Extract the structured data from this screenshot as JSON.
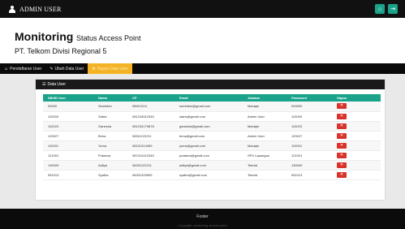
{
  "app": {
    "title": "ADMIN USER"
  },
  "topbar": {
    "home_icon": "home-icon",
    "logout_icon": "logout-icon"
  },
  "header": {
    "title_bold": "Monitoring",
    "title_rest": "Status Access Point",
    "subtitle": "PT. Telkom Divisi Regional 5"
  },
  "nav": {
    "items": [
      {
        "label": "Pendaftaran User",
        "icon": "user-plus-icon"
      },
      {
        "label": "Ubah Data User",
        "icon": "pencil-icon"
      },
      {
        "label": "Hapus Data User",
        "icon": "trash-icon",
        "active": true
      }
    ]
  },
  "panel": {
    "title": "Data User",
    "icon": "list-icon"
  },
  "table": {
    "columns": [
      "NIK/ID User",
      "Nama",
      "CP",
      "Email",
      "Jabatan",
      "Password",
      "Hapus"
    ],
    "rows": [
      [
        "00000",
        "Sembilan",
        "0892131X",
        "sembilan@gmail.com",
        "Manajer",
        "000000"
      ],
      [
        "110000",
        "Satria",
        "081234512345",
        "satria@gmail.com",
        "Admin User",
        "110000"
      ],
      [
        "110023",
        "Ganesha",
        "081234179878",
        "ganesha@gmail.com",
        "Manajer",
        "110023"
      ],
      [
        "120027",
        "Brina",
        "08311122211",
        "brina@gmail.com",
        "Admin User",
        "120027"
      ],
      [
        "110001",
        "Yoma",
        "08231314459",
        "yoma@gmail.com",
        "Manajer",
        "110001"
      ],
      [
        "121001",
        "Pratama",
        "087412412345",
        "pratama@gmail.com",
        "SPV Lapangan",
        "121001"
      ],
      [
        "130009",
        "Aditya",
        "08331122211",
        "aditya@gmail.com",
        "Teknisi",
        "130009"
      ],
      [
        "951013",
        "Syafira",
        "08331325999",
        "syafira@gmail.com",
        "Teknisi",
        "951013"
      ]
    ],
    "delete_icon": "x-icon"
  },
  "footer": {
    "title": "Footer",
    "subtitle": "Copyright monitoring access point"
  },
  "colors": {
    "accent": "#1aa38a",
    "active_tab": "#f3b324",
    "danger": "#d8322b",
    "dark": "#111111"
  }
}
